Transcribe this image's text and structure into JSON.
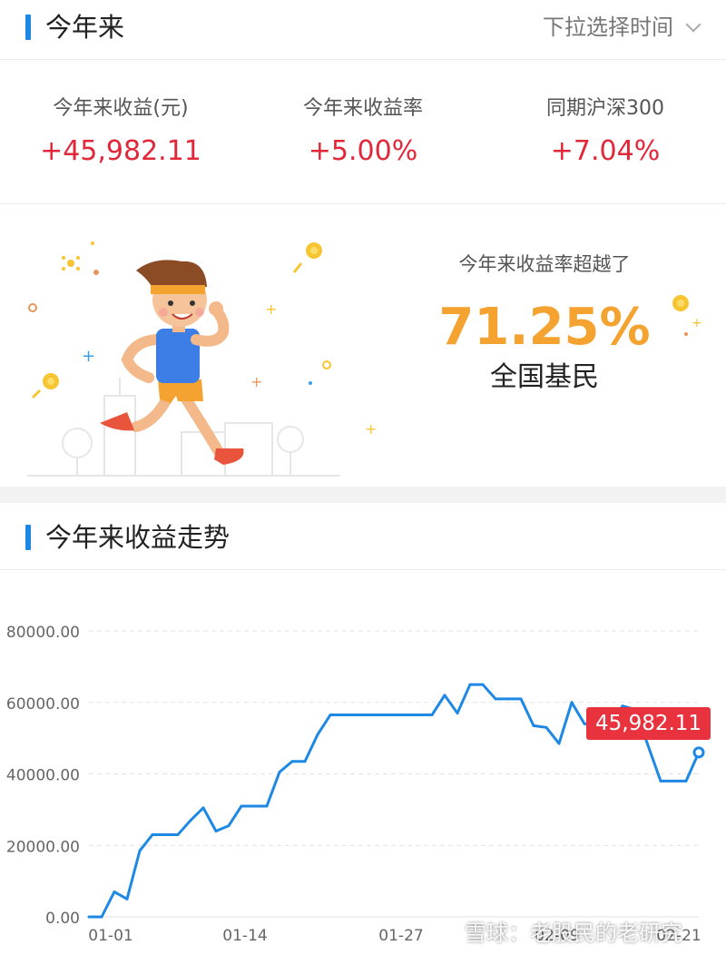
{
  "header": {
    "title": "今年来",
    "time_select": "下拉选择时间"
  },
  "stats": [
    {
      "label": "今年来收益(元)",
      "value": "+45,982.11"
    },
    {
      "label": "今年来收益率",
      "value": "+5.00%"
    },
    {
      "label": "同期沪深300",
      "value": "+7.04%"
    }
  ],
  "promo": {
    "caption": "今年来收益率超越了",
    "percent": "71.25%",
    "who": "全国基民"
  },
  "trend": {
    "title": "今年来收益走势"
  },
  "watermark": "雪球：老股民的老研究",
  "colors": {
    "accent": "#1e88e5",
    "gain": "#e0283a",
    "highlight": "#f5a330",
    "line": "#1e88e5"
  },
  "chart_data": {
    "type": "line",
    "title": "",
    "ylim": [
      0,
      80000
    ],
    "yticks": [
      "0.00",
      "20000.00",
      "40000.00",
      "60000.00",
      "80000.00"
    ],
    "xticks": [
      "01-01",
      "01-14",
      "01-27",
      "02-09",
      "02-21"
    ],
    "tooltip": "45,982.11",
    "series": [
      {
        "values": [
          0,
          0,
          7000,
          5000,
          18500,
          23000,
          23000,
          23000,
          27000,
          30500,
          24000,
          25500,
          31000,
          31000,
          31000,
          40500,
          43500,
          43500,
          51000,
          56500,
          56500,
          56500,
          56500,
          56500,
          56500,
          56500,
          56500,
          56500,
          62000,
          57000,
          65000,
          65000,
          61000,
          61000,
          61000,
          53500,
          53000,
          48500,
          60000,
          54000,
          54000,
          54000,
          59000,
          58000,
          48000,
          38000,
          38000,
          38000,
          46000
        ]
      }
    ]
  }
}
